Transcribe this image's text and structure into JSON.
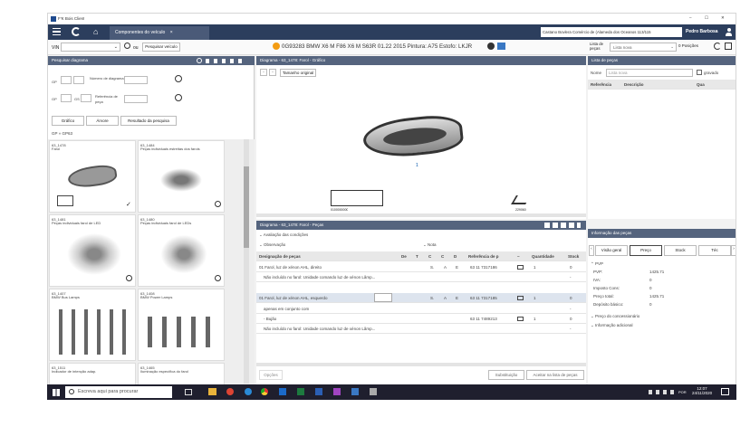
{
  "window": {
    "app_title": "F'K Bois Client",
    "controls": {
      "min": "–",
      "max": "☐",
      "close": "✕"
    }
  },
  "appbar": {
    "tab_label": "Componentes do veículo",
    "tab_close": "×",
    "dealer": "Castano Bovlera Comércio de (Alameda dos Oceanos 113/115",
    "user": "Pedro Barbosa"
  },
  "vinbar": {
    "vin_label": "VIN",
    "search_vehicle": "Pesquisar veículo",
    "ou": "ou",
    "vehicle_info": "0G93283 BMW X6 M F86 X6 M S63R 01.22 2015 Pintura: A75 Estofo: LKJR",
    "parts_list_label": "Lista de peças",
    "parts_list_value": "Lista nova",
    "positions": "0 Posições"
  },
  "left": {
    "header": "Pesquisar diagrama",
    "gp_label": "GP",
    "gs_label": "GS",
    "num_diagram_label": "Número de diagrama",
    "ref_label": "Referência de peça",
    "tabs": [
      "Gráfico",
      "Árvore",
      "Resultado da pesquisa"
    ],
    "breadcrumb": {
      "root": "GP",
      "sep": "»",
      "current": "GP63"
    },
    "thumbs": [
      {
        "code": "63_1478",
        "title": "Farol"
      },
      {
        "code": "63_1484",
        "title": "Peças individuais estreitas dos farois"
      },
      {
        "code": "63_1481",
        "title": "Peças individuais farol de LED"
      },
      {
        "code": "63_1480",
        "title": "Peças individuais farol de LEDs"
      },
      {
        "code": "63_1407",
        "title": "BMW Bus Lamps"
      },
      {
        "code": "63_1408",
        "title": "BMW Power Lamps"
      },
      {
        "code": "63_1511",
        "title": "Indicador de intenção adap."
      },
      {
        "code": "63_1465",
        "title": "Iluminação específica do farol"
      }
    ]
  },
  "diagram": {
    "header": "Diagrama - 63_1478: Farol - Gráfico",
    "size_btn": "Tamanho original",
    "callout": "1",
    "label_left": "0100000000",
    "label_right": "229060"
  },
  "parts": {
    "header": "Diagrama - 63_1478: Farol - Peças",
    "filter1": "Avaliação das condições",
    "filter2": "Observação",
    "filter3": "Nota",
    "columns": [
      "Designação de peças",
      "De",
      "T",
      "C",
      "C",
      "D",
      "Referência de p",
      "~",
      "Quantidade",
      "Stock"
    ],
    "rows": [
      {
        "name": "01 Farol, luz de xénon AHL, direito",
        "c1": "S.",
        "c2": "A",
        "c3": "E",
        "ref": "63 11 7317186",
        "qty": "1",
        "stock": "0"
      },
      {
        "name": "Não incluído no farol: Unidade comando luz de xénon Lâmp...",
        "c1": "",
        "c2": "",
        "c3": "",
        "ref": "",
        "qty": "",
        "stock": "-"
      },
      {
        "name": "01 Farol, luz de xénon AHL, esquerdo",
        "c1": "S.",
        "c2": "A",
        "c3": "E",
        "ref": "63 11 7317185",
        "qty": "1",
        "stock": "0"
      },
      {
        "name": "apenas em conjunto com",
        "c1": "",
        "c2": "",
        "c3": "",
        "ref": "",
        "qty": "",
        "stock": "-"
      },
      {
        "name": "- Bujão",
        "c1": "",
        "c2": "",
        "c3": "",
        "ref": "63 11 7489213",
        "qty": "1",
        "stock": "0"
      },
      {
        "name": "Não incluído no farol: Unidade comando luz de xénon Lâmp...",
        "c1": "",
        "c2": "",
        "c3": "",
        "ref": "",
        "qty": "",
        "stock": "-"
      }
    ],
    "footer_left": "Opções",
    "btn_sub": "Substituição",
    "btn_add": "Aceitar na lista de peças"
  },
  "partslist": {
    "header": "Lista de peças",
    "name_label": "Nome",
    "name_placeholder": "Lista nova",
    "saved": "gravado",
    "col_ref": "Referência",
    "col_desc": "Descrição",
    "col_qty": "Qua"
  },
  "info": {
    "header": "Informação das peças",
    "tabs": [
      "Visão geral",
      "Preço",
      "Stock",
      "Téc"
    ],
    "pvp_section": "PVP",
    "fields": [
      {
        "k": "PVP:",
        "v": "1425.71"
      },
      {
        "k": "IVA:",
        "v": "0"
      },
      {
        "k": "Imposto Cons:",
        "v": "0"
      },
      {
        "k": "Preço total:",
        "v": "1425.71"
      },
      {
        "k": "Depósito básico:",
        "v": "0"
      }
    ],
    "dealer_price": "Preço do concessionário",
    "extra": "Informação adicional"
  },
  "taskbar": {
    "search_placeholder": "Escreva aqui para procurar",
    "time": "12:07",
    "date": "24/11/2020",
    "lang": "POR"
  }
}
